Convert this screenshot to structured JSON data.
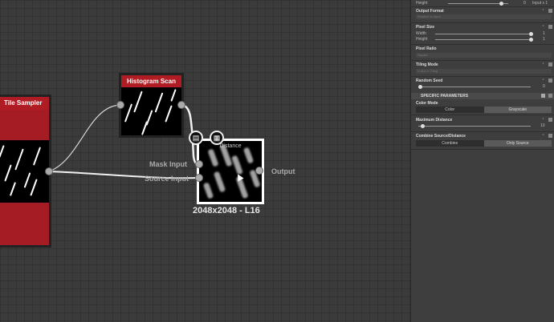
{
  "graph": {
    "nodes": {
      "tile_sampler": {
        "title": "Tile Sampler"
      },
      "histogram_scan": {
        "title": "Histogram Scan"
      },
      "distance": {
        "title": "Distance",
        "resolution": "2048x2048 - L16"
      }
    },
    "ports": {
      "mask_input": "Mask Input",
      "source_input": "Source Input",
      "output": "Output"
    }
  },
  "panel": {
    "height_label": "Height",
    "height_value": "0",
    "height_extra": "Input x 1",
    "output_format": {
      "label": "Output Format",
      "value": "Relative to input"
    },
    "pixel_size": {
      "label": "Pixel Size",
      "width_label": "Width",
      "width_value": "1",
      "height_label": "Height",
      "height_value": "1"
    },
    "pixel_ratio": {
      "label": "Pixel Ratio",
      "value": "Square"
    },
    "tiling_mode": {
      "label": "Tiling Mode",
      "value": "H and V Tiling"
    },
    "random_seed": {
      "label": "Random Seed",
      "value": "0"
    },
    "specific_parameters": "SPECIFIC PARAMETERS",
    "color_mode": {
      "label": "Color Mode",
      "options": [
        "Color",
        "Grayscale"
      ],
      "selected": "Grayscale"
    },
    "maximum_distance": {
      "label": "Maximum Distance",
      "value": "10"
    },
    "combine": {
      "label": "Combine Source/Distance",
      "options": [
        "Combine",
        "Only Source"
      ],
      "selected": "Only Source"
    }
  }
}
